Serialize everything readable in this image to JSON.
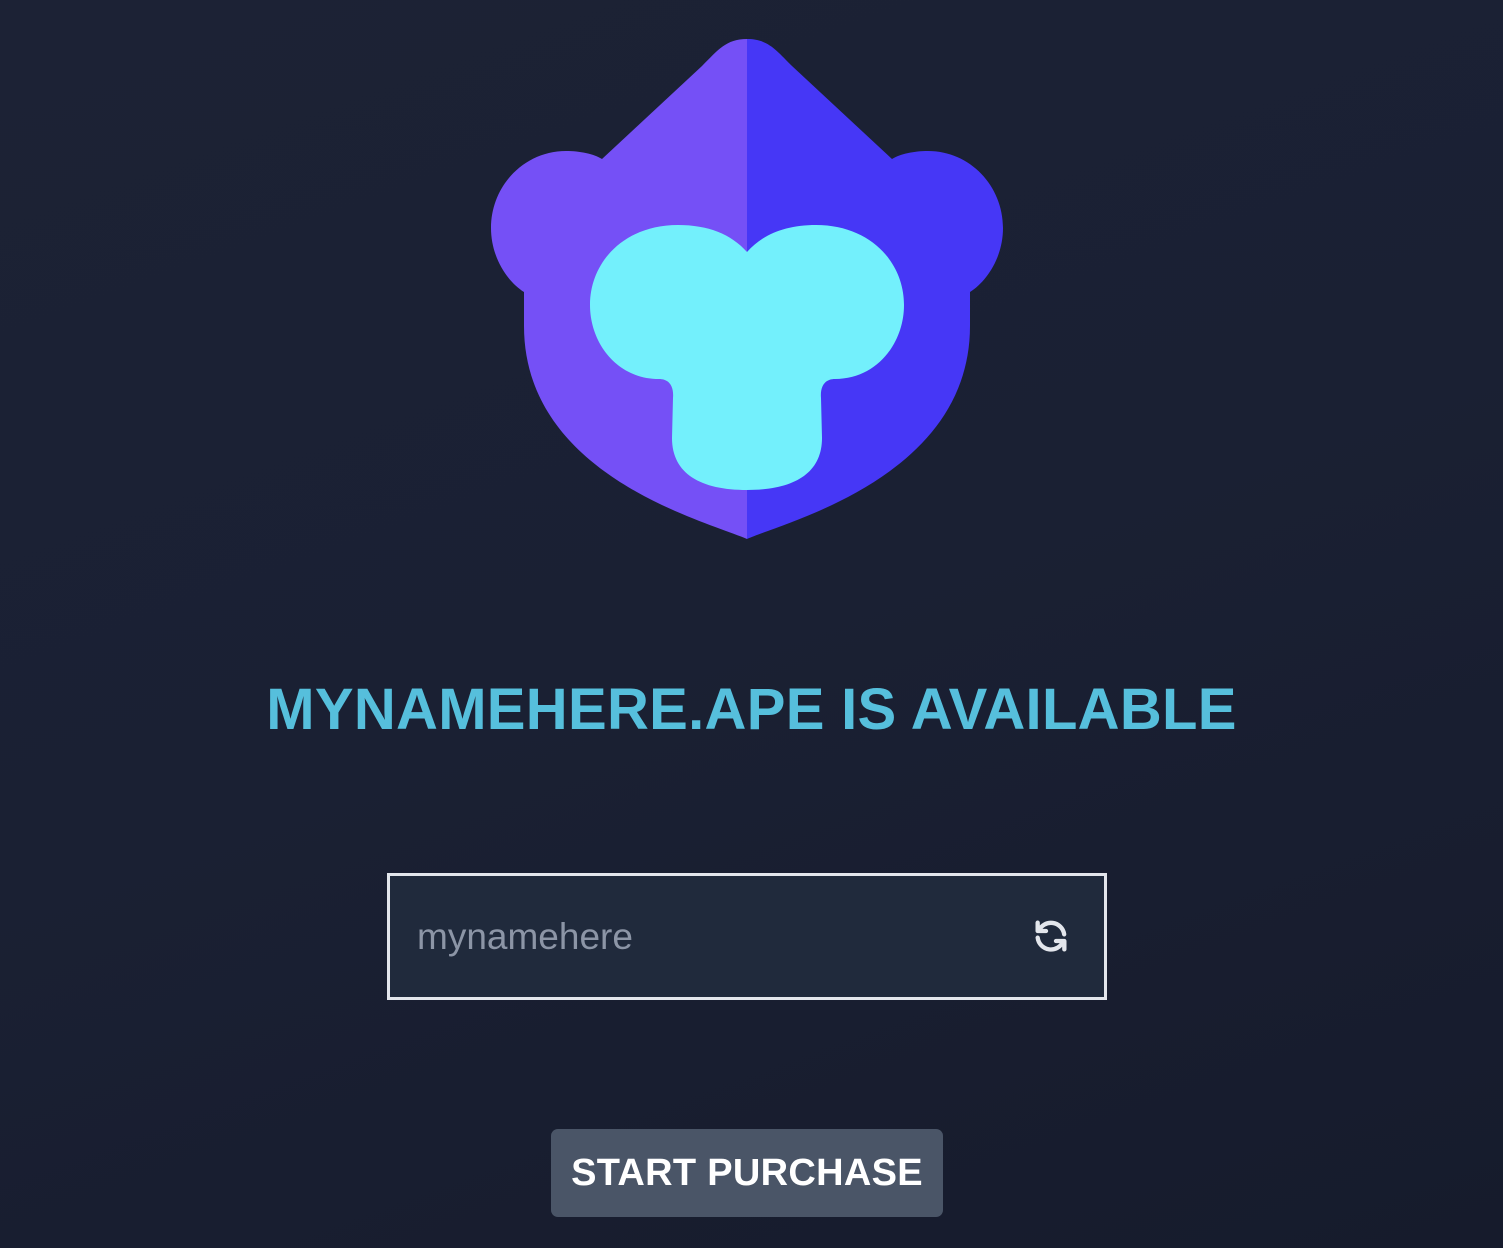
{
  "logo": {
    "icon": "ape-logo-icon",
    "colors": {
      "left": "#7550f6",
      "right": "#4637f6",
      "face": "#73f0fc"
    }
  },
  "headline": {
    "text": "MYNAMEHERE.APE IS AVAILABLE",
    "color": "#56bfdc"
  },
  "name_input": {
    "value": "",
    "placeholder": "mynamehere",
    "icon": "refresh-icon"
  },
  "purchase_button": {
    "label": "START PURCHASE",
    "background": "#4a5567"
  }
}
